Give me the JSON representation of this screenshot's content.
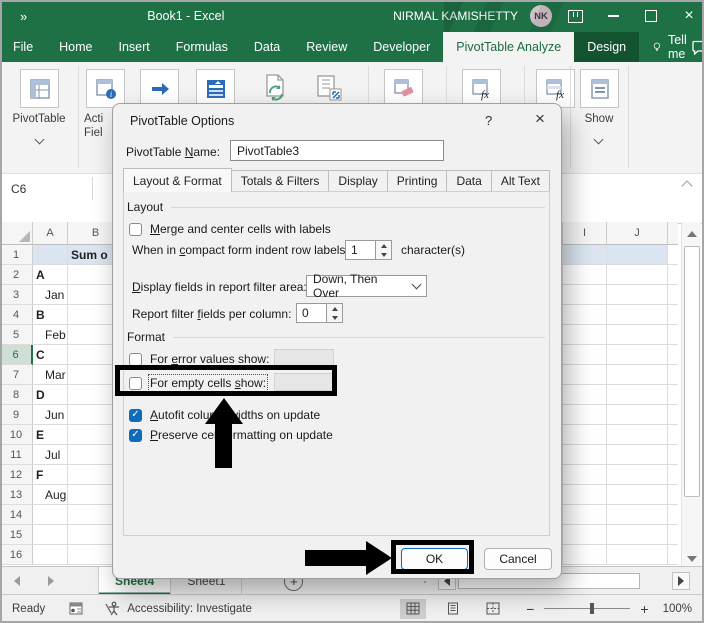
{
  "colors": {
    "excel_green": "#1E7145",
    "accent_green": "#217346",
    "design_tab_green": "#14532F",
    "checkbox_blue": "#0F6CBD",
    "pivot_header_fill": "#DBE5F1",
    "annotation_black": "#000000"
  },
  "titlebar": {
    "quick_access": "»",
    "title": "Book1 - Excel",
    "user_name": "NIRMAL KAMISHETTY",
    "avatar_initials": "NK"
  },
  "ribbon_tabs": [
    {
      "label": "File",
      "state": "normal"
    },
    {
      "label": "Home",
      "state": "normal"
    },
    {
      "label": "Insert",
      "state": "normal"
    },
    {
      "label": "Formulas",
      "state": "normal"
    },
    {
      "label": "Data",
      "state": "normal"
    },
    {
      "label": "Review",
      "state": "normal"
    },
    {
      "label": "Developer",
      "state": "normal"
    },
    {
      "label": "PivotTable Analyze",
      "state": "selected"
    },
    {
      "label": "Design",
      "state": "dark"
    }
  ],
  "tell_me_label": "Tell me",
  "ribbon": {
    "pivottable_label": "PivotTable",
    "active_field_line1": "Acti",
    "active_field_line2": "Fiel",
    "show_label": "Show"
  },
  "formula_bar": {
    "name_box": "C6"
  },
  "sheet": {
    "cols_left": [
      "A",
      "B"
    ],
    "cols_right": [
      "I",
      "J"
    ],
    "rows": [
      {
        "n": "1",
        "a": "",
        "b": "Sum o",
        "fill": true,
        "bold": true
      },
      {
        "n": "2",
        "a": "A",
        "bold": true
      },
      {
        "n": "3",
        "a": "Jan",
        "indent": true
      },
      {
        "n": "4",
        "a": "B",
        "bold": true
      },
      {
        "n": "5",
        "a": "Feb",
        "indent": true
      },
      {
        "n": "6",
        "a": "C",
        "bold": true,
        "selected_row": true
      },
      {
        "n": "7",
        "a": "Mar",
        "indent": true
      },
      {
        "n": "8",
        "a": "D",
        "bold": true
      },
      {
        "n": "9",
        "a": "Jun",
        "indent": true
      },
      {
        "n": "10",
        "a": "E",
        "bold": true
      },
      {
        "n": "11",
        "a": "Jul",
        "indent": true
      },
      {
        "n": "12",
        "a": "F",
        "bold": true
      },
      {
        "n": "13",
        "a": "Aug",
        "indent": true
      },
      {
        "n": "14",
        "a": ""
      },
      {
        "n": "15",
        "a": ""
      },
      {
        "n": "16",
        "a": ""
      }
    ]
  },
  "sheet_tabs": {
    "tabs": [
      {
        "label": "Sheet4",
        "state": "active"
      },
      {
        "label": "Sheet1",
        "state": "normal"
      }
    ],
    "add_label": "+"
  },
  "status": {
    "ready": "Ready",
    "accessibility": "Accessibility: Investigate",
    "zoom_out": "−",
    "zoom_in": "+",
    "zoom_level": "100%"
  },
  "dialog": {
    "title": "PivotTable Options",
    "help_glyph": "?",
    "close_glyph": "×",
    "name_label": {
      "text": "PivotTable Name:",
      "u": 11
    },
    "name_value": "PivotTable3",
    "tabs": [
      {
        "label": "Layout & Format",
        "state": "selected"
      },
      {
        "label": "Totals & Filters",
        "state": "normal"
      },
      {
        "label": "Display",
        "state": "normal"
      },
      {
        "label": "Printing",
        "state": "normal"
      },
      {
        "label": "Data",
        "state": "normal"
      },
      {
        "label": "Alt Text",
        "state": "normal"
      }
    ],
    "layout_group": "Layout",
    "merge_label": {
      "text": "Merge and center cells with labels",
      "u": 0
    },
    "merge_checked": false,
    "indent_label": {
      "text": "When in compact form indent row labels:",
      "u": 8
    },
    "indent_value": "1",
    "indent_suffix": "character(s)",
    "display_fields_label": {
      "text": "Display fields in report filter area:",
      "u": 0
    },
    "display_fields_value": "Down, Then Over",
    "report_filter_label": {
      "text": "Report filter fields per column:",
      "u": 14
    },
    "report_filter_value": "0",
    "format_group": "Format",
    "error_label": {
      "text": "For error values show:",
      "u": 4
    },
    "error_checked": false,
    "empty_label": {
      "text": "For empty cells show:",
      "u": 16
    },
    "empty_checked": false,
    "autofit_label": {
      "text": "Autofit column widths on update",
      "u": 0
    },
    "autofit_checked": true,
    "preserve_label": {
      "text": "Preserve cell formatting on update",
      "u": 0
    },
    "preserve_checked": true,
    "ok_label": "OK",
    "cancel_label": "Cancel",
    "check_glyph": "✓"
  }
}
